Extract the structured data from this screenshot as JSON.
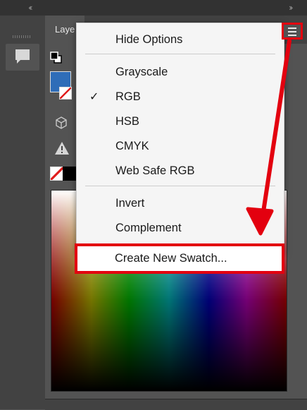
{
  "topbar": {
    "left_chevrons": "‹‹",
    "right_chevrons": "››"
  },
  "panel": {
    "tab_label": "Laye"
  },
  "menu": {
    "items": [
      {
        "label": "Hide Options",
        "checked": false
      },
      {
        "label": "Grayscale",
        "checked": false
      },
      {
        "label": "RGB",
        "checked": true
      },
      {
        "label": "HSB",
        "checked": false
      },
      {
        "label": "CMYK",
        "checked": false
      },
      {
        "label": "Web Safe RGB",
        "checked": false
      },
      {
        "label": "Invert",
        "checked": false
      },
      {
        "label": "Complement",
        "checked": false
      },
      {
        "label": "Create New Swatch...",
        "checked": false
      }
    ],
    "checkmark": "✓"
  },
  "colors": {
    "foreground": "#2f6db8",
    "annotation_red": "#e3000f",
    "menu_bg": "#f5f5f5",
    "panel_bg": "#535353"
  },
  "icons": [
    "chevrons-left-icon",
    "chevrons-right-icon",
    "comment-icon",
    "swap-colors-icon",
    "cube-icon",
    "warning-icon",
    "no-color-icon",
    "hamburger-menu-icon",
    "annotation-arrow"
  ]
}
